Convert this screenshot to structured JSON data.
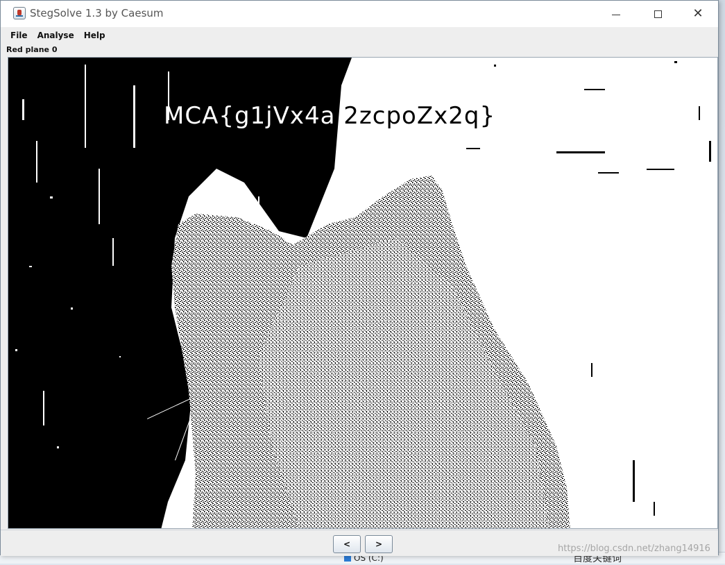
{
  "window": {
    "title": "StegSolve 1.3 by Caesum",
    "close_glyph": "✕"
  },
  "menu": {
    "items": [
      "File",
      "Analyse",
      "Help"
    ]
  },
  "view": {
    "plane_label": "Red plane 0",
    "hidden_text_white": "MCA{g1jVx4a",
    "hidden_text_black": "2zcpoZx2q}"
  },
  "nav": {
    "prev_label": "<",
    "next_label": ">"
  },
  "taskbar": {
    "drive_label": "OS (C:)",
    "ime_label": "百度关键词"
  },
  "watermark": "https://blog.csdn.net/zhang14916",
  "colors": {
    "foreground_pixels": "#000000",
    "background_pixels": "#ffffff",
    "window_chrome": "#eeeeee"
  }
}
